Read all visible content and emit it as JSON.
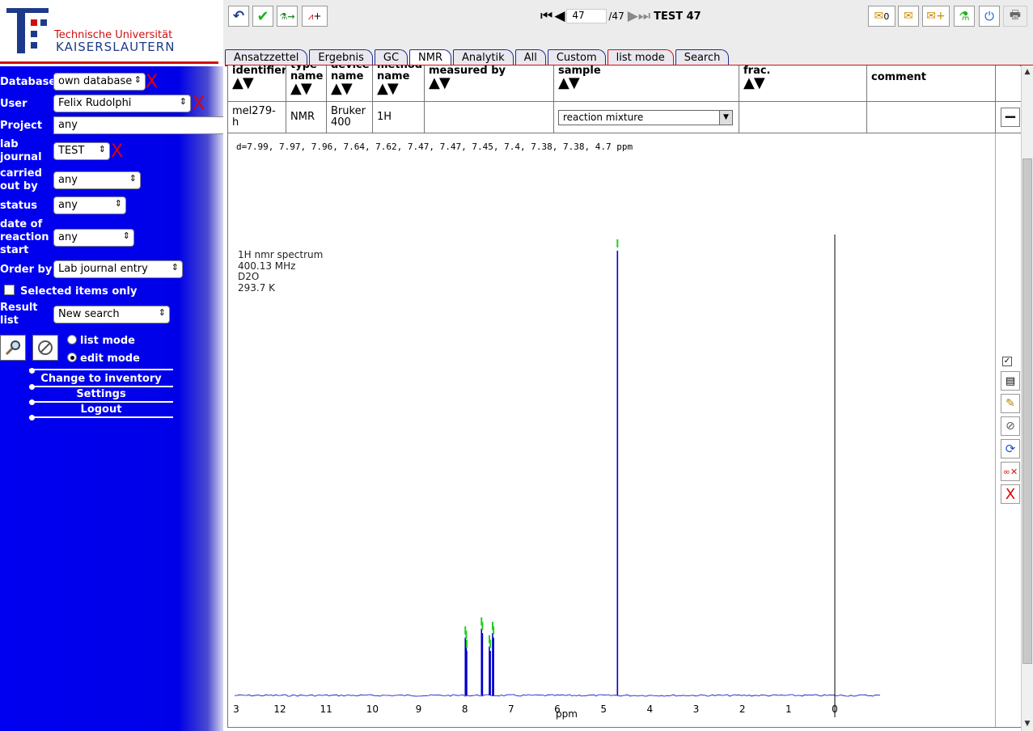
{
  "logo": {
    "line1": "Technische Universität",
    "line2": "KAISERSLAUTERN"
  },
  "filters": {
    "database": {
      "label": "Database",
      "value": "own database"
    },
    "user": {
      "label": "User",
      "value": "Felix Rudolphi"
    },
    "project": {
      "label": "Project",
      "value": "any"
    },
    "lab_journal": {
      "label1": "lab",
      "label2": "journal",
      "value": "TEST"
    },
    "carried_out_by": {
      "label1": "carried",
      "label2": "out by",
      "value": "any"
    },
    "status": {
      "label": "status",
      "value": "any"
    },
    "date_start": {
      "label1": "date of",
      "label2": "reaction",
      "label3": "start",
      "value": "any"
    },
    "order_by": {
      "label": "Order by",
      "value": "Lab journal entry"
    },
    "selected_only": {
      "label": "Selected items only"
    },
    "result_list": {
      "label1": "Result",
      "label2": "list",
      "value": "New search"
    },
    "clear_mark": "X"
  },
  "modes": {
    "list": "list mode",
    "edit": "edit mode",
    "selected": "edit"
  },
  "links": {
    "inventory": "Change to inventory",
    "settings": "Settings",
    "logout": "Logout"
  },
  "pager": {
    "current": "47",
    "total": "/47",
    "title": "TEST 47"
  },
  "toolbar": {
    "inbox_count": "0"
  },
  "tabs": [
    "Ansatzzettel",
    "Ergebnis",
    "GC",
    "NMR",
    "Analytik",
    "All",
    "Custom",
    "list mode",
    "Search"
  ],
  "active_tab": "NMR",
  "table": {
    "headers": {
      "identifier": "identifier",
      "type_name1": "type",
      "type_name2": "name",
      "device_name1": "device",
      "device_name2": "name",
      "method_name1": "method",
      "method_name2": "name",
      "measured_by": "measured by",
      "sample": "sample",
      "frac": "frac.",
      "comment": "comment"
    },
    "row": {
      "identifier": "mel279-h",
      "type": "NMR",
      "device1": "Bruker",
      "device2": "400",
      "method": "1H",
      "measured_by": "",
      "sample": "reaction mixture",
      "frac": "",
      "comment": ""
    }
  },
  "spectrum": {
    "peaks_text": "d=7.99, 7.97, 7.96, 7.64, 7.62, 7.47, 7.47, 7.45, 7.4, 7.38, 7.38, 4.7 ppm",
    "info_line1": "1H nmr spectrum",
    "info_line2": "400.13 MHz",
    "info_line3": "D2O",
    "info_line4": "293.7 K",
    "axis_label": "ppm",
    "ticks": [
      "3",
      "12",
      "11",
      "10",
      "9",
      "8",
      "7",
      "6",
      "5",
      "4",
      "3",
      "2",
      "1",
      "0"
    ],
    "peaks_ppm": [
      7.99,
      7.97,
      7.96,
      7.64,
      7.62,
      7.47,
      7.45,
      7.4,
      7.38,
      4.7
    ],
    "peak_intensity": [
      0.13,
      0.12,
      0.1,
      0.15,
      0.14,
      0.11,
      0.1,
      0.14,
      0.13,
      1.0
    ],
    "line_color": "#0000cc",
    "marker_color": "#22cc22"
  }
}
